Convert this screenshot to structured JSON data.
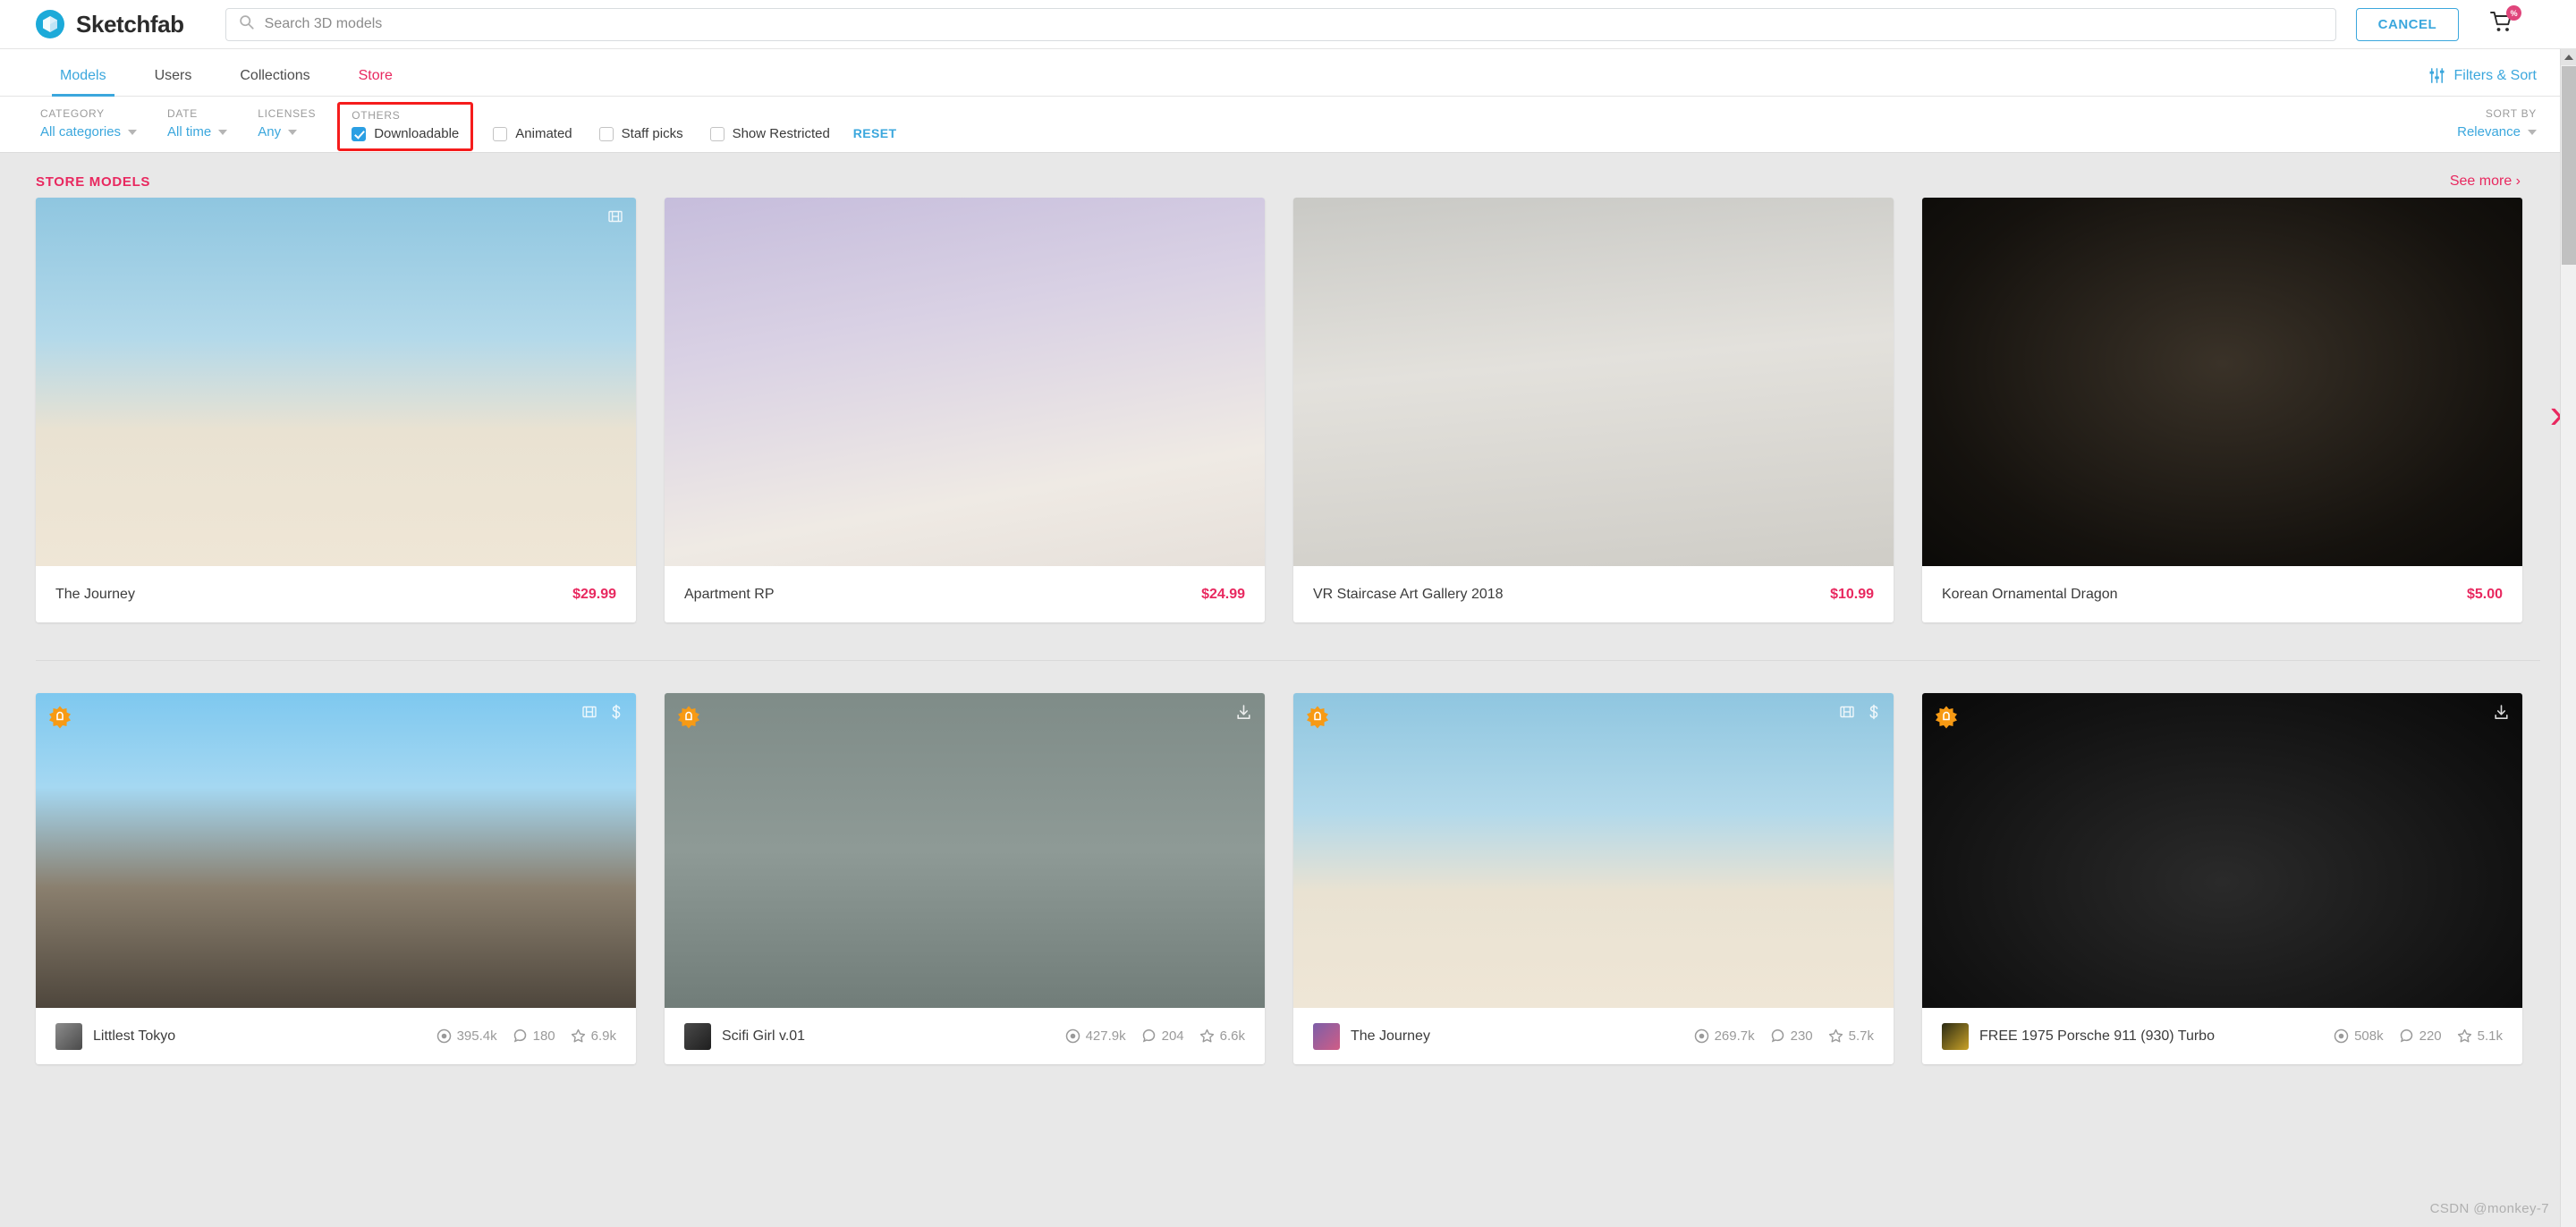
{
  "header": {
    "brand": "Sketchfab",
    "logo_icon": "sketchfab-logo-icon",
    "search": {
      "placeholder": "Search 3D models",
      "value": "",
      "icon": "search-icon"
    },
    "cancel_label": "CANCEL",
    "cart": {
      "icon": "shopping-cart-icon",
      "badge": "%"
    }
  },
  "tabs": [
    {
      "label": "Models",
      "active": true
    },
    {
      "label": "Users",
      "active": false
    },
    {
      "label": "Collections",
      "active": false
    },
    {
      "label": "Store",
      "active": false,
      "accent": "#e8285f"
    }
  ],
  "filters_sort": {
    "label": "Filters & Sort",
    "icon": "sliders-icon"
  },
  "filters": {
    "category": {
      "label": "CATEGORY",
      "value": "All categories"
    },
    "date": {
      "label": "DATE",
      "value": "All time"
    },
    "licenses": {
      "label": "LICENSES",
      "value": "Any"
    },
    "others": {
      "label": "OTHERS",
      "highlighted": true,
      "checkbox": {
        "label": "Downloadable",
        "checked": true
      }
    },
    "inline_checks": [
      {
        "label": "Animated",
        "checked": false
      },
      {
        "label": "Staff picks",
        "checked": false
      },
      {
        "label": "Show Restricted",
        "checked": false
      }
    ],
    "reset_label": "RESET",
    "sort_by": {
      "label": "SORT BY",
      "value": "Relevance"
    }
  },
  "store_section": {
    "title": "STORE MODELS",
    "see_more": "See more ›",
    "carousel_next_icon": "chevron-right-icon",
    "cards": [
      {
        "title": "The Journey",
        "price": "$29.99",
        "art": "art-journey",
        "corner_icons": [
          "film-icon"
        ]
      },
      {
        "title": "Apartment RP",
        "price": "$24.99",
        "art": "art-apartment",
        "corner_icons": []
      },
      {
        "title": "VR Staircase Art Gallery 2018",
        "price": "$10.99",
        "art": "art-gallery",
        "corner_icons": []
      },
      {
        "title": "Korean Ornamental Dragon",
        "price": "$5.00",
        "art": "art-dragon",
        "corner_icons": []
      }
    ]
  },
  "model_results": {
    "cards": [
      {
        "title": "Littlest Tokyo",
        "art": "art-tokyo",
        "avatar": "av1",
        "award_badge": true,
        "corner_icons": [
          "film-icon",
          "dollar-icon"
        ],
        "views": "395.4k",
        "comments": "180",
        "likes": "6.9k"
      },
      {
        "title": "Scifi Girl v.01",
        "art": "art-scifi",
        "avatar": "av2",
        "award_badge": true,
        "corner_icons": [
          "download-icon"
        ],
        "views": "427.9k",
        "comments": "204",
        "likes": "6.6k"
      },
      {
        "title": "The Journey",
        "art": "art-journey",
        "avatar": "av3",
        "award_badge": true,
        "corner_icons": [
          "film-icon",
          "dollar-icon"
        ],
        "views": "269.7k",
        "comments": "230",
        "likes": "5.7k"
      },
      {
        "title": "FREE 1975 Porsche 911 (930) Turbo",
        "art": "art-porsche",
        "avatar": "av4",
        "award_badge": true,
        "corner_icons": [
          "download-icon"
        ],
        "views": "508k",
        "comments": "220",
        "likes": "5.1k"
      }
    ]
  },
  "watermark": "CSDN @monkey-7"
}
